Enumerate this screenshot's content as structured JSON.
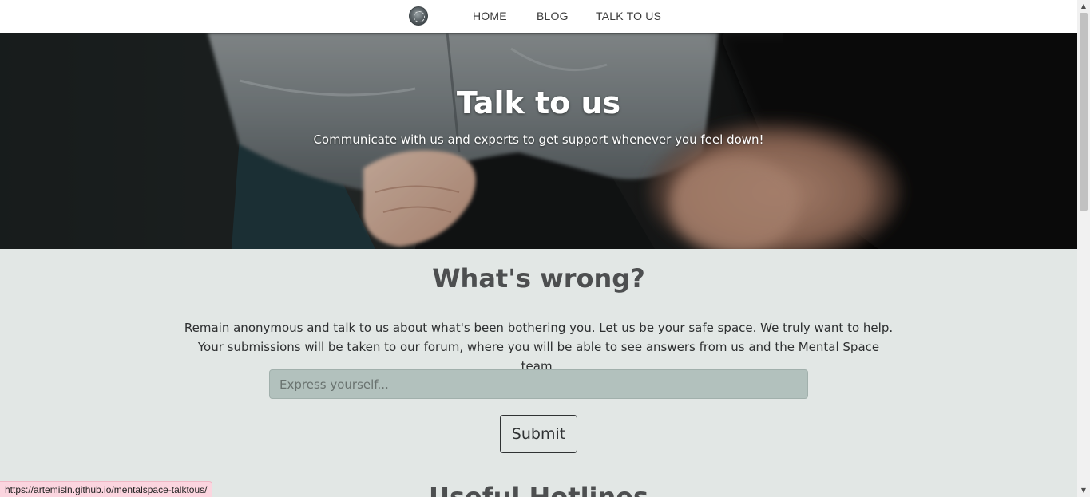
{
  "nav": {
    "logo": "mental-space-logo",
    "links": [
      "HOME",
      "BLOG",
      "TALK TO US"
    ]
  },
  "hero": {
    "title": "Talk to us",
    "subtitle": "Communicate with us and experts to get support whenever you feel down!"
  },
  "main": {
    "heading": "What's wrong?",
    "intro": "Remain anonymous and talk to us about what's been bothering you. Let us be your safe space. We truly want to help. Your submissions will be taken to our forum, where you will be able to see answers from us and the Mental Space team.",
    "input": {
      "placeholder": "Express yourself...",
      "value": ""
    },
    "submit_label": "Submit",
    "next_heading": "Useful Hotlines"
  },
  "status_bar": {
    "url": "https://artemisln.github.io/mentalspace-talktous/"
  },
  "colors": {
    "page_bg": "#e2e7e5",
    "input_bg": "#b2c1bd",
    "heading": "#4d4f50",
    "status_bg": "#fbd5df"
  }
}
